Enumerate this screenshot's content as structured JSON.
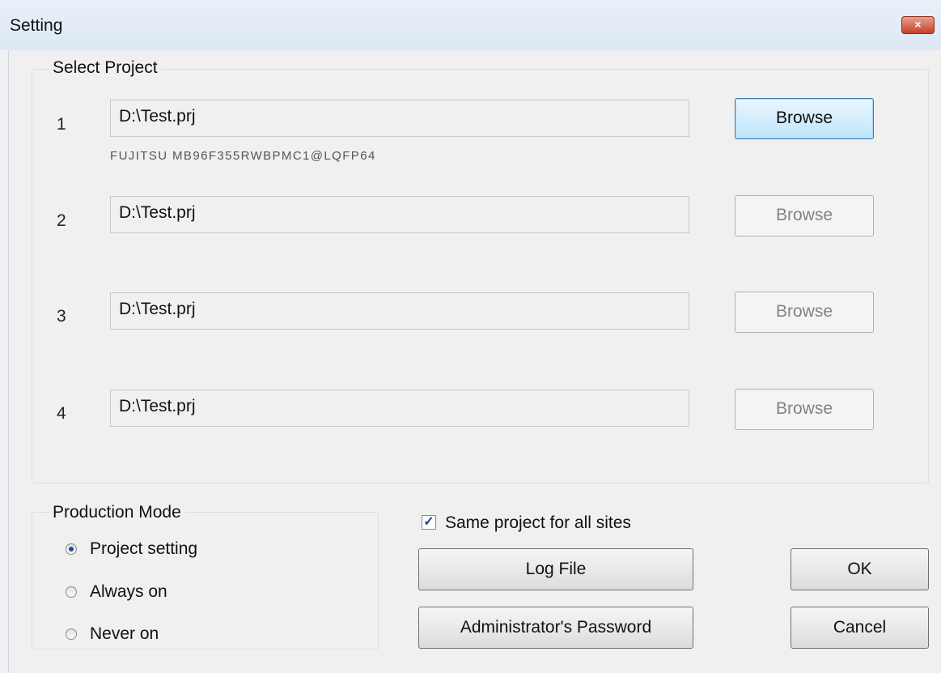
{
  "window": {
    "title": "Setting",
    "close_label": "×"
  },
  "select_project": {
    "title": "Select Project",
    "rows": [
      {
        "num": "1",
        "path": "D:\\Test.prj",
        "browse": "Browse",
        "chip": "FUJITSU MB96F355RWBPMC1@LQFP64"
      },
      {
        "num": "2",
        "path": "D:\\Test.prj",
        "browse": "Browse"
      },
      {
        "num": "3",
        "path": "D:\\Test.prj",
        "browse": "Browse"
      },
      {
        "num": "4",
        "path": "D:\\Test.prj",
        "browse": "Browse"
      }
    ]
  },
  "production_mode": {
    "title": "Production Mode",
    "options": [
      "Project setting",
      "Always on",
      "Never on"
    ],
    "selected": "Project setting"
  },
  "same_project": {
    "label": "Same project for all sites",
    "checked": true,
    "check_glyph": "✓"
  },
  "buttons": {
    "log_file": "Log File",
    "admin_password": "Administrator's Password",
    "ok": "OK",
    "cancel": "Cancel"
  },
  "colors": {
    "accent_focus": "#3c7fb1",
    "radio_dot": "#1c4d9a",
    "close_red": "#c7412a"
  }
}
